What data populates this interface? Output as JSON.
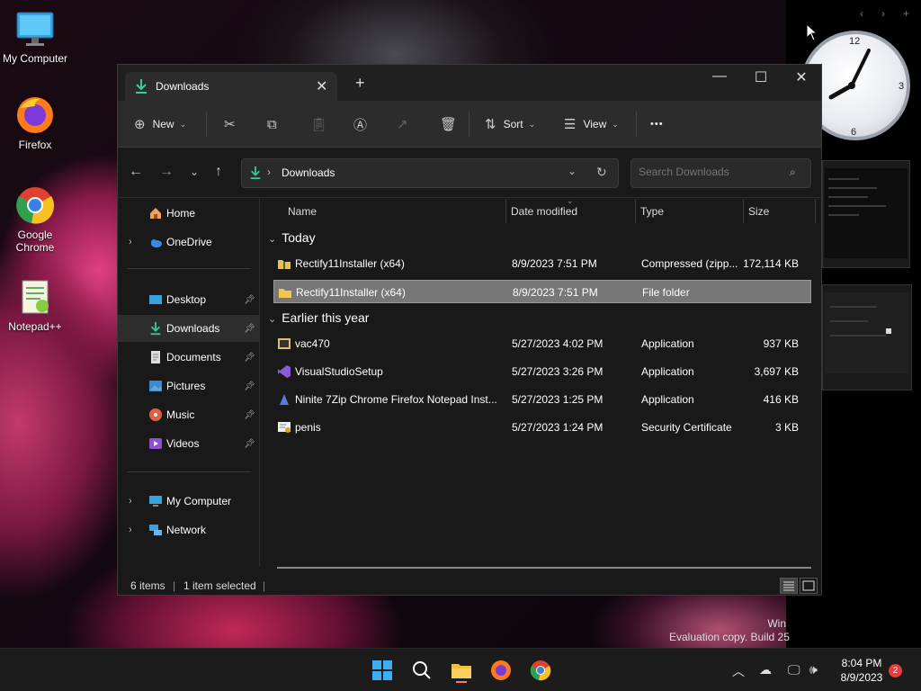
{
  "desktop": {
    "icons": [
      {
        "label": "My Computer",
        "icon": "monitor-icon"
      },
      {
        "label": "Firefox",
        "icon": "firefox-icon"
      },
      {
        "label": "Google Chrome",
        "icon": "chrome-icon"
      },
      {
        "label": "Notepad++",
        "icon": "notepadpp-icon"
      }
    ],
    "watermark_line1": "Win",
    "watermark_line2": "Evaluation copy. Build 25"
  },
  "clock_gadget": {
    "numbers": [
      "12",
      "3",
      "6"
    ],
    "nav_prev": "‹",
    "nav_next": "›",
    "nav_add": "+"
  },
  "explorer": {
    "tab_title": "Downloads",
    "tab_close": "✕",
    "new_tab": "+",
    "window_controls": {
      "minimize": "—",
      "maximize": "☐",
      "close": "✕"
    },
    "toolbar": {
      "new_label": "New",
      "sort_label": "Sort",
      "view_label": "View",
      "more_label": "•••"
    },
    "address": {
      "separator": "›",
      "location": "Downloads"
    },
    "search": {
      "placeholder": "Search Downloads"
    },
    "nav": {
      "home": "Home",
      "onedrive": "OneDrive",
      "desktop": "Desktop",
      "downloads": "Downloads",
      "documents": "Documents",
      "pictures": "Pictures",
      "music": "Music",
      "videos": "Videos",
      "my_computer": "My Computer",
      "network": "Network"
    },
    "columns": {
      "name": "Name",
      "date": "Date modified",
      "type": "Type",
      "size": "Size"
    },
    "groups": {
      "today": "Today",
      "earlier": "Earlier this year"
    },
    "files_today": [
      {
        "name": "Rectify11Installer (x64)",
        "date": "8/9/2023 7:51 PM",
        "type": "Compressed (zipp...",
        "size": "172,114 KB",
        "icon": "zip-folder-icon",
        "selected": false
      },
      {
        "name": "Rectify11Installer (x64)",
        "date": "8/9/2023 7:51 PM",
        "type": "File folder",
        "size": "",
        "icon": "folder-icon",
        "selected": true
      }
    ],
    "files_earlier": [
      {
        "name": "vac470",
        "date": "5/27/2023 4:02 PM",
        "type": "Application",
        "size": "937 KB",
        "icon": "app-icon"
      },
      {
        "name": "VisualStudioSetup",
        "date": "5/27/2023 3:26 PM",
        "type": "Application",
        "size": "3,697 KB",
        "icon": "visualstudio-icon"
      },
      {
        "name": "Ninite 7Zip Chrome Firefox Notepad Inst...",
        "date": "5/27/2023 1:25 PM",
        "type": "Application",
        "size": "416 KB",
        "icon": "ninite-icon"
      },
      {
        "name": "penis",
        "date": "5/27/2023 1:24 PM",
        "type": "Security Certificate",
        "size": "3 KB",
        "icon": "certificate-icon"
      }
    ],
    "status": {
      "items": "6 items",
      "selected": "1 item selected"
    }
  },
  "taskbar": {
    "time": "8:04 PM",
    "date": "8/9/2023",
    "notification_count": "2"
  }
}
